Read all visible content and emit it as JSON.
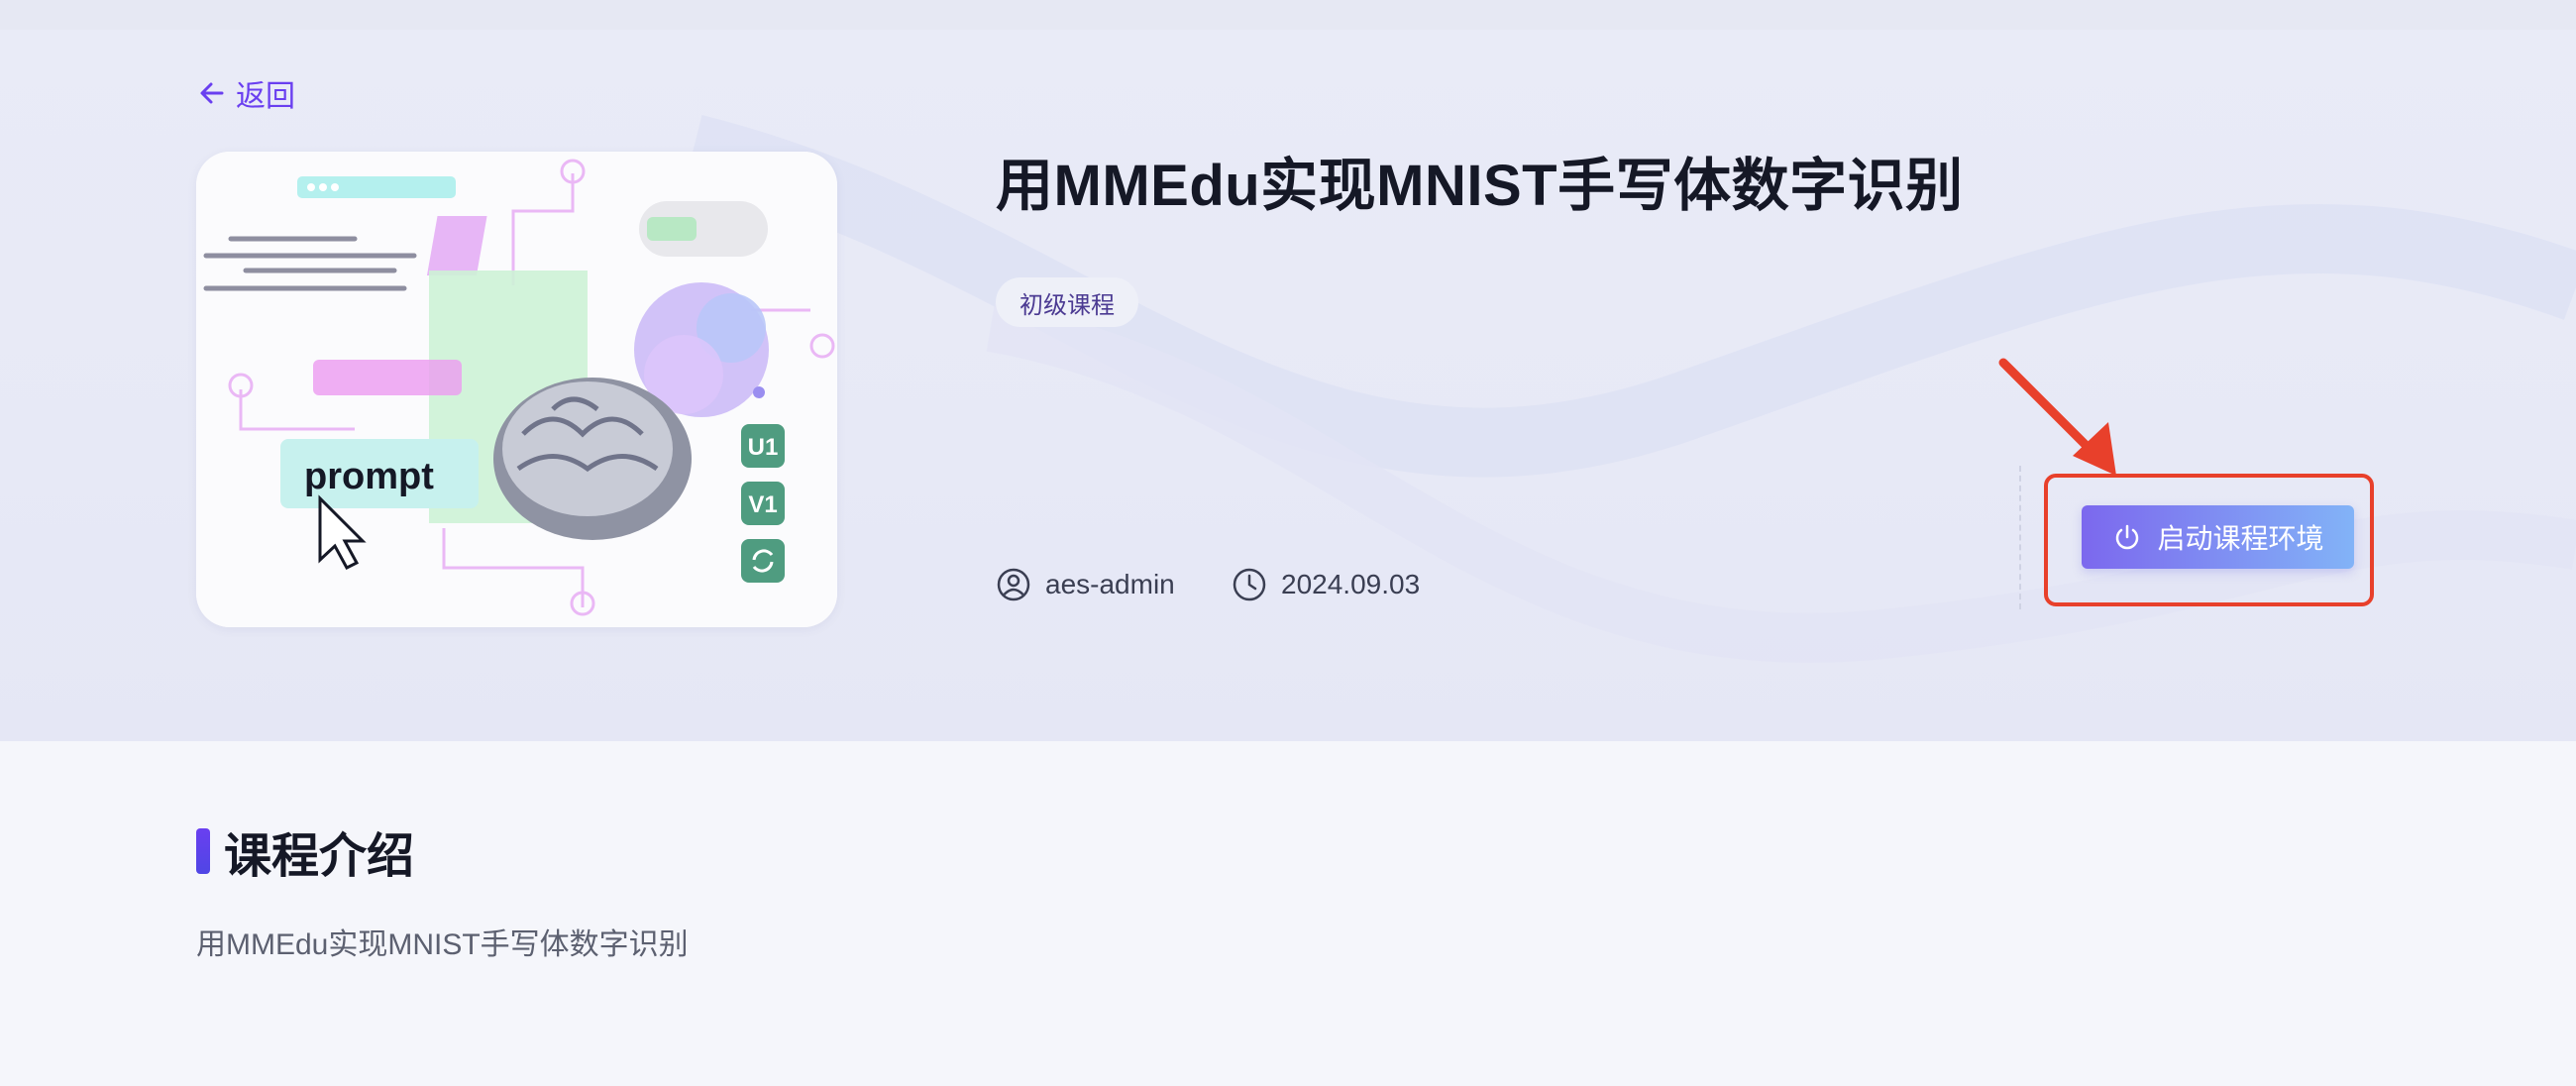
{
  "nav": {
    "back_label": "返回",
    "back_icon": "arrow-left-icon"
  },
  "course": {
    "title": "用MMEdu实现MNIST手写体数字识别",
    "tag": "初级课程",
    "author": "aes-admin",
    "date": "2024.09.03",
    "cover": {
      "prompt_text": "prompt",
      "badges": [
        "U1",
        "V1"
      ],
      "refresh_icon": "refresh-icon"
    }
  },
  "actions": {
    "launch_label": "启动课程环境",
    "launch_icon": "power-icon"
  },
  "intro": {
    "heading": "课程介绍",
    "body": "用MMEdu实现MNIST手写体数字识别"
  },
  "colors": {
    "accent": "#6a3ff0",
    "button_gradient_start": "#7c68ee",
    "button_gradient_end": "#82b3f7",
    "annotation": "#e8402b"
  }
}
